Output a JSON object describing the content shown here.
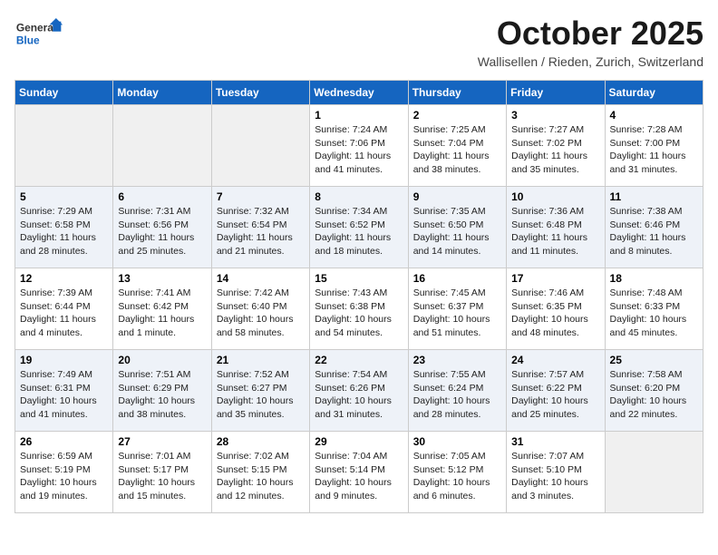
{
  "header": {
    "logo_general": "General",
    "logo_blue": "Blue",
    "month": "October 2025",
    "location": "Wallisellen / Rieden, Zurich, Switzerland"
  },
  "days_of_week": [
    "Sunday",
    "Monday",
    "Tuesday",
    "Wednesday",
    "Thursday",
    "Friday",
    "Saturday"
  ],
  "weeks": [
    [
      {
        "day": "",
        "empty": true
      },
      {
        "day": "",
        "empty": true
      },
      {
        "day": "",
        "empty": true
      },
      {
        "day": "1",
        "sunrise": "7:24 AM",
        "sunset": "7:06 PM",
        "daylight": "11 hours and 41 minutes."
      },
      {
        "day": "2",
        "sunrise": "7:25 AM",
        "sunset": "7:04 PM",
        "daylight": "11 hours and 38 minutes."
      },
      {
        "day": "3",
        "sunrise": "7:27 AM",
        "sunset": "7:02 PM",
        "daylight": "11 hours and 35 minutes."
      },
      {
        "day": "4",
        "sunrise": "7:28 AM",
        "sunset": "7:00 PM",
        "daylight": "11 hours and 31 minutes."
      }
    ],
    [
      {
        "day": "5",
        "sunrise": "7:29 AM",
        "sunset": "6:58 PM",
        "daylight": "11 hours and 28 minutes."
      },
      {
        "day": "6",
        "sunrise": "7:31 AM",
        "sunset": "6:56 PM",
        "daylight": "11 hours and 25 minutes."
      },
      {
        "day": "7",
        "sunrise": "7:32 AM",
        "sunset": "6:54 PM",
        "daylight": "11 hours and 21 minutes."
      },
      {
        "day": "8",
        "sunrise": "7:34 AM",
        "sunset": "6:52 PM",
        "daylight": "11 hours and 18 minutes."
      },
      {
        "day": "9",
        "sunrise": "7:35 AM",
        "sunset": "6:50 PM",
        "daylight": "11 hours and 14 minutes."
      },
      {
        "day": "10",
        "sunrise": "7:36 AM",
        "sunset": "6:48 PM",
        "daylight": "11 hours and 11 minutes."
      },
      {
        "day": "11",
        "sunrise": "7:38 AM",
        "sunset": "6:46 PM",
        "daylight": "11 hours and 8 minutes."
      }
    ],
    [
      {
        "day": "12",
        "sunrise": "7:39 AM",
        "sunset": "6:44 PM",
        "daylight": "11 hours and 4 minutes."
      },
      {
        "day": "13",
        "sunrise": "7:41 AM",
        "sunset": "6:42 PM",
        "daylight": "11 hours and 1 minute."
      },
      {
        "day": "14",
        "sunrise": "7:42 AM",
        "sunset": "6:40 PM",
        "daylight": "10 hours and 58 minutes."
      },
      {
        "day": "15",
        "sunrise": "7:43 AM",
        "sunset": "6:38 PM",
        "daylight": "10 hours and 54 minutes."
      },
      {
        "day": "16",
        "sunrise": "7:45 AM",
        "sunset": "6:37 PM",
        "daylight": "10 hours and 51 minutes."
      },
      {
        "day": "17",
        "sunrise": "7:46 AM",
        "sunset": "6:35 PM",
        "daylight": "10 hours and 48 minutes."
      },
      {
        "day": "18",
        "sunrise": "7:48 AM",
        "sunset": "6:33 PM",
        "daylight": "10 hours and 45 minutes."
      }
    ],
    [
      {
        "day": "19",
        "sunrise": "7:49 AM",
        "sunset": "6:31 PM",
        "daylight": "10 hours and 41 minutes."
      },
      {
        "day": "20",
        "sunrise": "7:51 AM",
        "sunset": "6:29 PM",
        "daylight": "10 hours and 38 minutes."
      },
      {
        "day": "21",
        "sunrise": "7:52 AM",
        "sunset": "6:27 PM",
        "daylight": "10 hours and 35 minutes."
      },
      {
        "day": "22",
        "sunrise": "7:54 AM",
        "sunset": "6:26 PM",
        "daylight": "10 hours and 31 minutes."
      },
      {
        "day": "23",
        "sunrise": "7:55 AM",
        "sunset": "6:24 PM",
        "daylight": "10 hours and 28 minutes."
      },
      {
        "day": "24",
        "sunrise": "7:57 AM",
        "sunset": "6:22 PM",
        "daylight": "10 hours and 25 minutes."
      },
      {
        "day": "25",
        "sunrise": "7:58 AM",
        "sunset": "6:20 PM",
        "daylight": "10 hours and 22 minutes."
      }
    ],
    [
      {
        "day": "26",
        "sunrise": "6:59 AM",
        "sunset": "5:19 PM",
        "daylight": "10 hours and 19 minutes."
      },
      {
        "day": "27",
        "sunrise": "7:01 AM",
        "sunset": "5:17 PM",
        "daylight": "10 hours and 15 minutes."
      },
      {
        "day": "28",
        "sunrise": "7:02 AM",
        "sunset": "5:15 PM",
        "daylight": "10 hours and 12 minutes."
      },
      {
        "day": "29",
        "sunrise": "7:04 AM",
        "sunset": "5:14 PM",
        "daylight": "10 hours and 9 minutes."
      },
      {
        "day": "30",
        "sunrise": "7:05 AM",
        "sunset": "5:12 PM",
        "daylight": "10 hours and 6 minutes."
      },
      {
        "day": "31",
        "sunrise": "7:07 AM",
        "sunset": "5:10 PM",
        "daylight": "10 hours and 3 minutes."
      },
      {
        "day": "",
        "empty": true
      }
    ]
  ]
}
